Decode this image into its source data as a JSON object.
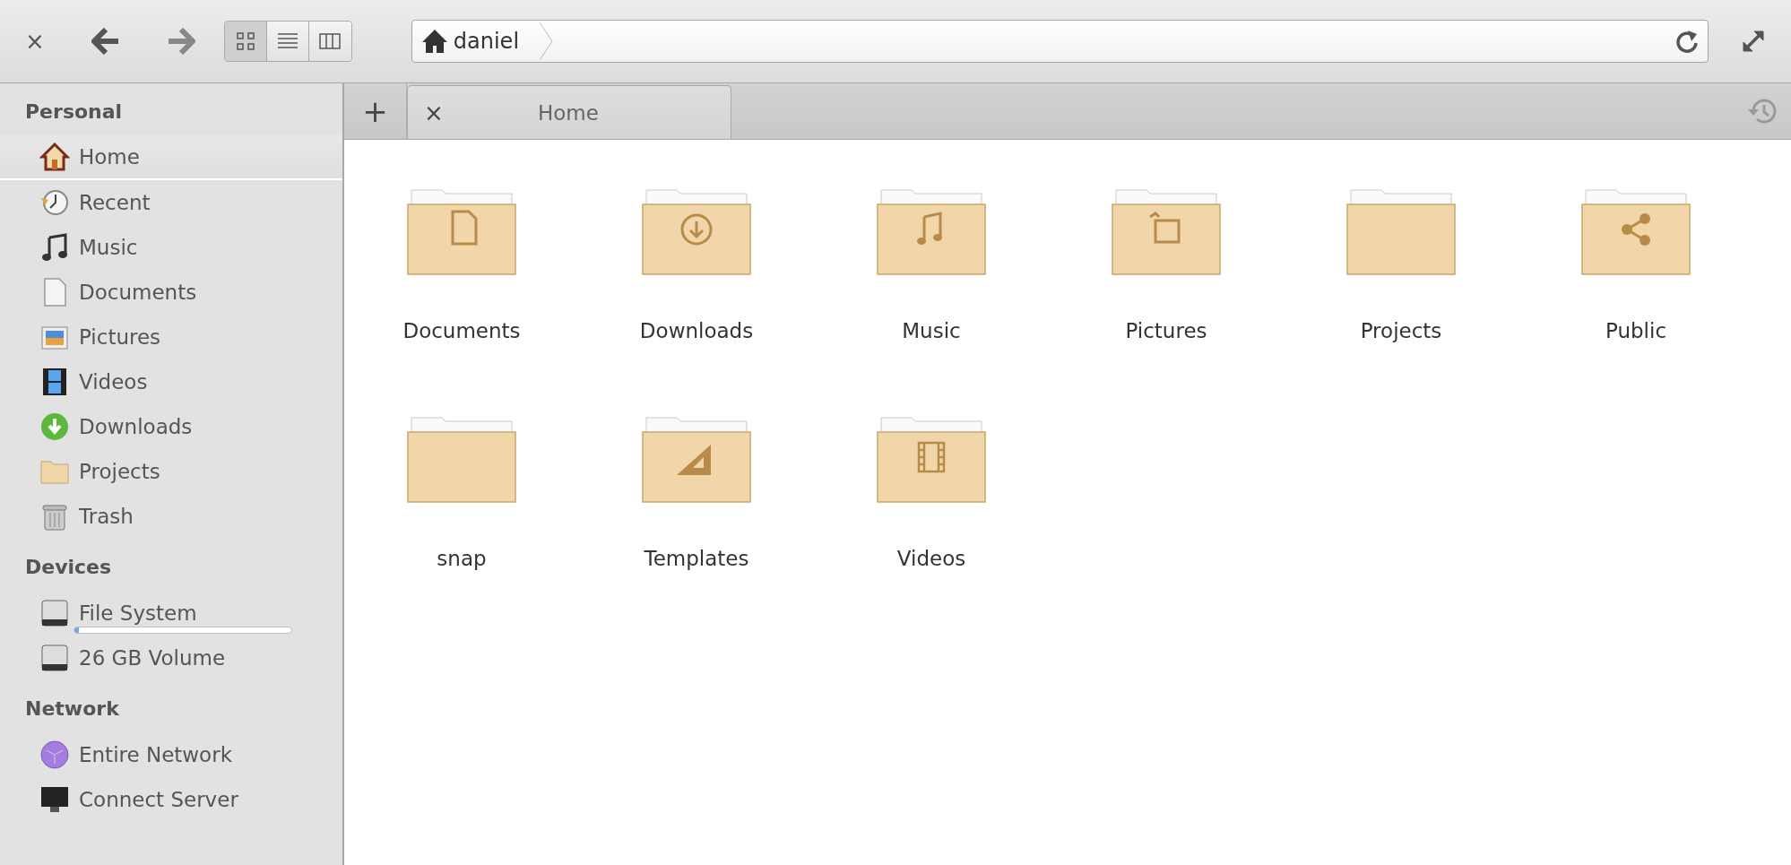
{
  "toolbar": {
    "close": "×",
    "views": [
      {
        "selected": true
      },
      {
        "selected": false
      },
      {
        "selected": false
      }
    ]
  },
  "path_bar": {
    "segments": [
      "daniel"
    ]
  },
  "tabs": [
    {
      "label": "Home",
      "close": "×",
      "selected": true
    }
  ],
  "new_tab": "+",
  "sidebar": {
    "sections": [
      {
        "title": "Personal",
        "items": [
          {
            "label": "Home",
            "selected": true
          },
          {
            "label": "Recent",
            "selected": false
          },
          {
            "label": "Music",
            "selected": false
          },
          {
            "label": "Documents",
            "selected": false
          },
          {
            "label": "Pictures",
            "selected": false
          },
          {
            "label": "Videos",
            "selected": false
          },
          {
            "label": "Downloads",
            "selected": false
          },
          {
            "label": "Projects",
            "selected": false
          },
          {
            "label": "Trash",
            "selected": false
          }
        ]
      },
      {
        "title": "Devices",
        "items": [
          {
            "label": "File System",
            "selected": false,
            "level": 0.02
          },
          {
            "label": "26 GB Volume",
            "selected": false
          }
        ]
      },
      {
        "title": "Network",
        "items": [
          {
            "label": "Entire Network",
            "selected": false
          },
          {
            "label": "Connect Server",
            "selected": false
          }
        ]
      }
    ]
  },
  "folders": [
    {
      "name": "Documents",
      "kind": "document"
    },
    {
      "name": "Downloads",
      "kind": "download"
    },
    {
      "name": "Music",
      "kind": "music"
    },
    {
      "name": "Pictures",
      "kind": "pictures"
    },
    {
      "name": "Projects",
      "kind": "plain"
    },
    {
      "name": "Public",
      "kind": "share"
    },
    {
      "name": "snap",
      "kind": "plain"
    },
    {
      "name": "Templates",
      "kind": "templates"
    },
    {
      "name": "Videos",
      "kind": "video"
    }
  ]
}
